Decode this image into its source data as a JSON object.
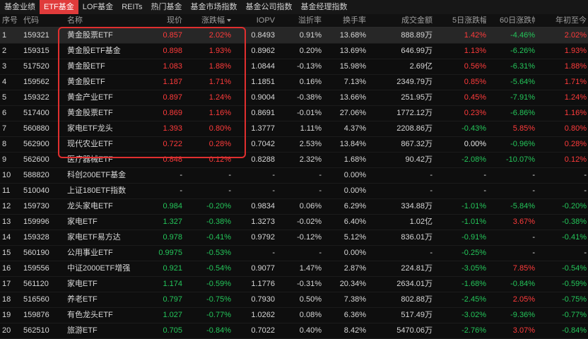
{
  "tabs": [
    "基金业绩",
    "ETF基金",
    "LOF基金",
    "REITs",
    "热门基金",
    "基金市场指数",
    "基金公司指数",
    "基金经理指数"
  ],
  "active_tab": 1,
  "columns": {
    "no": "序号",
    "code": "代码",
    "name": "名称",
    "price": "现价",
    "chg": "涨跌幅",
    "iopv": "IOPV",
    "prem": "溢折率",
    "turn": "换手率",
    "amt": "成交金额",
    "d5": "5日涨跌幅",
    "d60": "60日涨跌幅",
    "ytd": "年初至今"
  },
  "rows": [
    {
      "no": "1",
      "code": "159321",
      "name": "黄金股票ETF",
      "price": "0.857",
      "chg": "2.02%",
      "iopv": "0.8493",
      "prem": "0.91%",
      "turn": "13.68%",
      "amt": "888.89万",
      "d5": "1.42%",
      "d60": "-4.46%",
      "ytd": "2.02%",
      "price_c": "red",
      "chg_c": "red",
      "d5_c": "red",
      "d60_c": "green",
      "ytd_c": "red"
    },
    {
      "no": "2",
      "code": "159315",
      "name": "黄金股ETF基金",
      "price": "0.898",
      "chg": "1.93%",
      "iopv": "0.8962",
      "prem": "0.20%",
      "turn": "13.69%",
      "amt": "646.99万",
      "d5": "1.13%",
      "d60": "-6.26%",
      "ytd": "1.93%",
      "price_c": "red",
      "chg_c": "red",
      "d5_c": "red",
      "d60_c": "green",
      "ytd_c": "red"
    },
    {
      "no": "3",
      "code": "517520",
      "name": "黄金股ETF",
      "price": "1.083",
      "chg": "1.88%",
      "iopv": "1.0844",
      "prem": "-0.13%",
      "turn": "15.98%",
      "amt": "2.69亿",
      "d5": "0.56%",
      "d60": "-6.31%",
      "ytd": "1.88%",
      "price_c": "red",
      "chg_c": "red",
      "d5_c": "red",
      "d60_c": "green",
      "ytd_c": "red"
    },
    {
      "no": "4",
      "code": "159562",
      "name": "黄金股ETF",
      "price": "1.187",
      "chg": "1.71%",
      "iopv": "1.1851",
      "prem": "0.16%",
      "turn": "7.13%",
      "amt": "2349.79万",
      "d5": "0.85%",
      "d60": "-5.64%",
      "ytd": "1.71%",
      "price_c": "red",
      "chg_c": "red",
      "d5_c": "red",
      "d60_c": "green",
      "ytd_c": "red"
    },
    {
      "no": "5",
      "code": "159322",
      "name": "黄金产业ETF",
      "price": "0.897",
      "chg": "1.24%",
      "iopv": "0.9004",
      "prem": "-0.38%",
      "turn": "13.66%",
      "amt": "251.95万",
      "d5": "0.45%",
      "d60": "-7.91%",
      "ytd": "1.24%",
      "price_c": "red",
      "chg_c": "red",
      "d5_c": "red",
      "d60_c": "green",
      "ytd_c": "red"
    },
    {
      "no": "6",
      "code": "517400",
      "name": "黄金股票ETF",
      "price": "0.869",
      "chg": "1.16%",
      "iopv": "0.8691",
      "prem": "-0.01%",
      "turn": "27.06%",
      "amt": "1772.12万",
      "d5": "0.23%",
      "d60": "-6.86%",
      "ytd": "1.16%",
      "price_c": "red",
      "chg_c": "red",
      "d5_c": "red",
      "d60_c": "green",
      "ytd_c": "red"
    },
    {
      "no": "7",
      "code": "560880",
      "name": "家电ETF龙头",
      "price": "1.393",
      "chg": "0.80%",
      "iopv": "1.3777",
      "prem": "1.11%",
      "turn": "4.37%",
      "amt": "2208.86万",
      "d5": "-0.43%",
      "d60": "5.85%",
      "ytd": "0.80%",
      "price_c": "red",
      "chg_c": "red",
      "d5_c": "green",
      "d60_c": "red",
      "ytd_c": "red"
    },
    {
      "no": "8",
      "code": "562900",
      "name": "现代农业ETF",
      "price": "0.722",
      "chg": "0.28%",
      "iopv": "0.7042",
      "prem": "2.53%",
      "turn": "13.84%",
      "amt": "867.32万",
      "d5": "0.00%",
      "d60": "-0.96%",
      "ytd": "0.28%",
      "price_c": "red",
      "chg_c": "red",
      "d5_c": "white",
      "d60_c": "green",
      "ytd_c": "red"
    },
    {
      "no": "9",
      "code": "562600",
      "name": "医疗器械ETF",
      "price": "0.848",
      "chg": "0.12%",
      "iopv": "0.8288",
      "prem": "2.32%",
      "turn": "1.68%",
      "amt": "90.42万",
      "d5": "-2.08%",
      "d60": "-10.07%",
      "ytd": "0.12%",
      "price_c": "red",
      "chg_c": "red",
      "d5_c": "green",
      "d60_c": "green",
      "ytd_c": "red"
    },
    {
      "no": "10",
      "code": "588820",
      "name": "科创200ETF基金",
      "price": "-",
      "chg": "-",
      "iopv": "-",
      "prem": "-",
      "turn": "0.00%",
      "amt": "-",
      "d5": "-",
      "d60": "-",
      "ytd": "-",
      "price_c": "white",
      "chg_c": "white",
      "d5_c": "white",
      "d60_c": "white",
      "ytd_c": "white"
    },
    {
      "no": "11",
      "code": "510040",
      "name": "上证180ETF指数",
      "price": "-",
      "chg": "-",
      "iopv": "-",
      "prem": "-",
      "turn": "0.00%",
      "amt": "-",
      "d5": "-",
      "d60": "-",
      "ytd": "-",
      "price_c": "white",
      "chg_c": "white",
      "d5_c": "white",
      "d60_c": "white",
      "ytd_c": "white"
    },
    {
      "no": "12",
      "code": "159730",
      "name": "龙头家电ETF",
      "price": "0.984",
      "chg": "-0.20%",
      "iopv": "0.9834",
      "prem": "0.06%",
      "turn": "6.29%",
      "amt": "334.88万",
      "d5": "-1.01%",
      "d60": "-5.84%",
      "ytd": "-0.20%",
      "price_c": "green",
      "chg_c": "green",
      "d5_c": "green",
      "d60_c": "green",
      "ytd_c": "green"
    },
    {
      "no": "13",
      "code": "159996",
      "name": "家电ETF",
      "price": "1.327",
      "chg": "-0.38%",
      "iopv": "1.3273",
      "prem": "-0.02%",
      "turn": "6.40%",
      "amt": "1.02亿",
      "d5": "-1.01%",
      "d60": "3.67%",
      "ytd": "-0.38%",
      "price_c": "green",
      "chg_c": "green",
      "d5_c": "green",
      "d60_c": "red",
      "ytd_c": "green"
    },
    {
      "no": "14",
      "code": "159328",
      "name": "家电ETF易方达",
      "price": "0.978",
      "chg": "-0.41%",
      "iopv": "0.9792",
      "prem": "-0.12%",
      "turn": "5.12%",
      "amt": "836.01万",
      "d5": "-0.91%",
      "d60": "-",
      "ytd": "-0.41%",
      "price_c": "green",
      "chg_c": "green",
      "d5_c": "green",
      "d60_c": "white",
      "ytd_c": "green"
    },
    {
      "no": "15",
      "code": "560190",
      "name": "公用事业ETF",
      "price": "0.9975",
      "chg": "-0.53%",
      "iopv": "-",
      "prem": "-",
      "turn": "0.00%",
      "amt": "-",
      "d5": "-0.25%",
      "d60": "-",
      "ytd": "-",
      "price_c": "green",
      "chg_c": "green",
      "d5_c": "green",
      "d60_c": "white",
      "ytd_c": "white"
    },
    {
      "no": "16",
      "code": "159556",
      "name": "中证2000ETF增强",
      "price": "0.921",
      "chg": "-0.54%",
      "iopv": "0.9077",
      "prem": "1.47%",
      "turn": "2.87%",
      "amt": "224.81万",
      "d5": "-3.05%",
      "d60": "7.85%",
      "ytd": "-0.54%",
      "price_c": "green",
      "chg_c": "green",
      "d5_c": "green",
      "d60_c": "red",
      "ytd_c": "green"
    },
    {
      "no": "17",
      "code": "561120",
      "name": "家电ETF",
      "price": "1.174",
      "chg": "-0.59%",
      "iopv": "1.1776",
      "prem": "-0.31%",
      "turn": "20.34%",
      "amt": "2634.01万",
      "d5": "-1.68%",
      "d60": "-0.84%",
      "ytd": "-0.59%",
      "price_c": "green",
      "chg_c": "green",
      "d5_c": "green",
      "d60_c": "green",
      "ytd_c": "green"
    },
    {
      "no": "18",
      "code": "516560",
      "name": "养老ETF",
      "price": "0.797",
      "chg": "-0.75%",
      "iopv": "0.7930",
      "prem": "0.50%",
      "turn": "7.38%",
      "amt": "802.88万",
      "d5": "-2.45%",
      "d60": "2.05%",
      "ytd": "-0.75%",
      "price_c": "green",
      "chg_c": "green",
      "d5_c": "green",
      "d60_c": "red",
      "ytd_c": "green"
    },
    {
      "no": "19",
      "code": "159876",
      "name": "有色龙头ETF",
      "price": "1.027",
      "chg": "-0.77%",
      "iopv": "1.0262",
      "prem": "0.08%",
      "turn": "6.36%",
      "amt": "517.49万",
      "d5": "-3.02%",
      "d60": "-9.36%",
      "ytd": "-0.77%",
      "price_c": "green",
      "chg_c": "green",
      "d5_c": "green",
      "d60_c": "green",
      "ytd_c": "green"
    },
    {
      "no": "20",
      "code": "562510",
      "name": "旅游ETF",
      "price": "0.705",
      "chg": "-0.84%",
      "iopv": "0.7022",
      "prem": "0.40%",
      "turn": "8.42%",
      "amt": "5470.06万",
      "d5": "-2.76%",
      "d60": "3.07%",
      "ytd": "-0.84%",
      "price_c": "green",
      "chg_c": "green",
      "d5_c": "green",
      "d60_c": "red",
      "ytd_c": "green"
    }
  ],
  "colors": {
    "up": "#ff3b3b",
    "down": "#24c65a",
    "highlight": "#e02f2f",
    "active_tab": "#e03b3b"
  },
  "sort_indicator_icon": "sort-desc-icon"
}
